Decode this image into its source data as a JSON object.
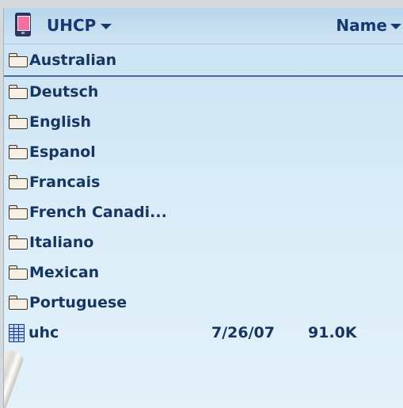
{
  "header": {
    "current_folder": "UHCP",
    "sort_label": "Name"
  },
  "icons": {
    "device": "device-icon",
    "dropdown": "chevron-down-icon",
    "folder": "folder-icon",
    "file": "file-grid-icon"
  },
  "colors": {
    "background": "#d9ecf8",
    "header": "#cfe4f3",
    "text": "#17365f",
    "selection_line": "#4b6896",
    "device_screen": "#f16fa3"
  },
  "items": [
    {
      "name": "Australian",
      "type": "folder",
      "selected": true
    },
    {
      "name": "Deutsch",
      "type": "folder"
    },
    {
      "name": "English",
      "type": "folder"
    },
    {
      "name": "Espanol",
      "type": "folder"
    },
    {
      "name": "Francais",
      "type": "folder"
    },
    {
      "name": "French Canadi...",
      "type": "folder"
    },
    {
      "name": "Italiano",
      "type": "folder"
    },
    {
      "name": "Mexican",
      "type": "folder"
    },
    {
      "name": "Portuguese",
      "type": "folder"
    },
    {
      "name": "uhc",
      "type": "file",
      "date": "7/26/07",
      "size": "91.0K"
    }
  ]
}
